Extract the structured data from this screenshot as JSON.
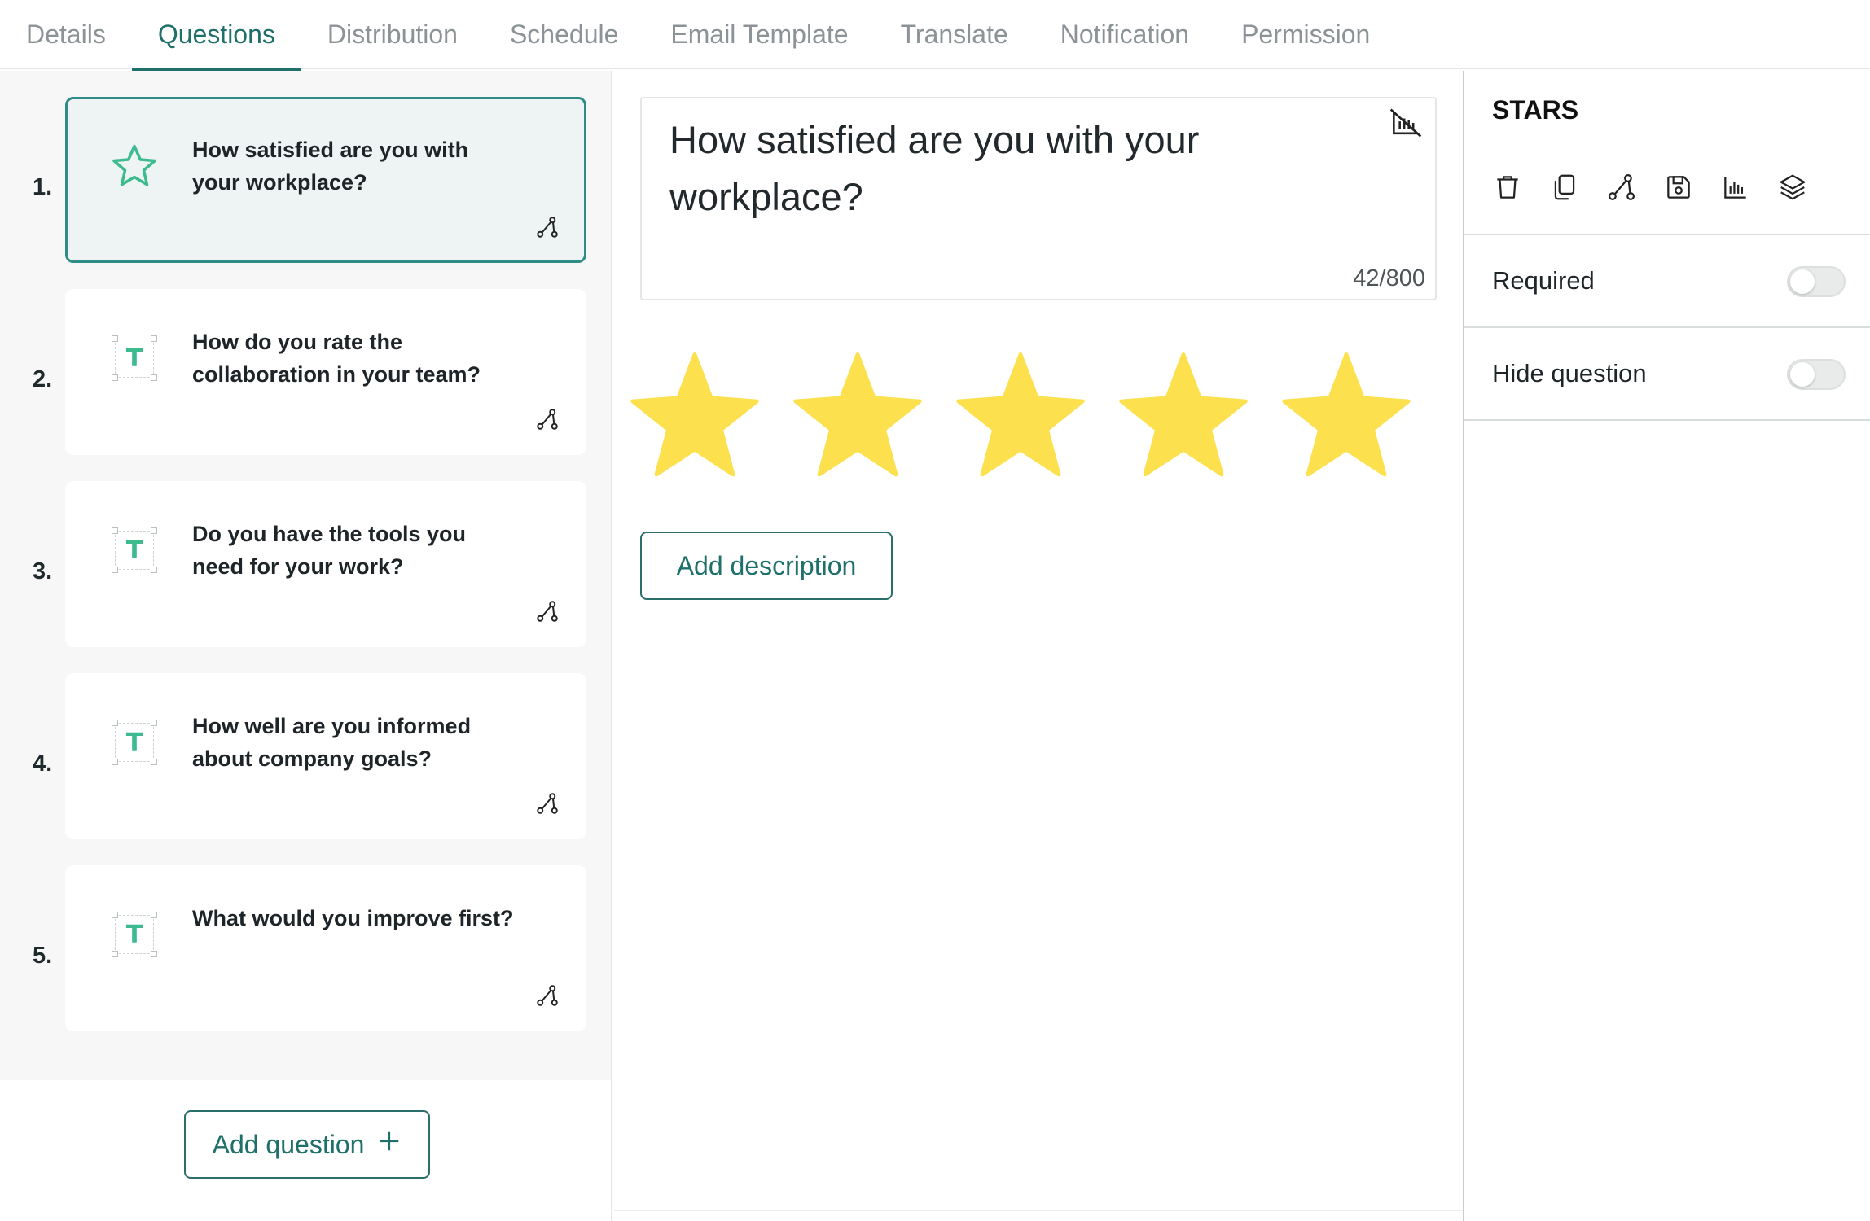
{
  "tabs": [
    {
      "label": "Details"
    },
    {
      "label": "Questions"
    },
    {
      "label": "Distribution"
    },
    {
      "label": "Schedule"
    },
    {
      "label": "Email Template"
    },
    {
      "label": "Translate"
    },
    {
      "label": "Notification"
    },
    {
      "label": "Permission"
    }
  ],
  "active_tab": "Questions",
  "questions": [
    {
      "number": "1.",
      "text": "How satisfied are you with your workplace?",
      "type_icon": "star-icon",
      "selected": true
    },
    {
      "number": "2.",
      "text": "How do you rate the collaboration in your team?",
      "type_icon": "text-icon",
      "type_letter": "T"
    },
    {
      "number": "3.",
      "text": "Do you have the tools you need for your work?",
      "type_icon": "text-icon",
      "type_letter": "T"
    },
    {
      "number": "4.",
      "text": "How well are you informed about company goals?",
      "type_icon": "text-icon",
      "type_letter": "T"
    },
    {
      "number": "5.",
      "text": "What would you improve first?",
      "type_icon": "text-icon",
      "type_letter": "T"
    }
  ],
  "add_question_label": "Add question",
  "editor": {
    "question_text": "How satisfied are you with your workplace?",
    "char_count": "42/800",
    "star_count": 5,
    "add_description_label": "Add description"
  },
  "settings_panel": {
    "title": "STARS",
    "tools": [
      "trash-icon",
      "copy-icon",
      "logic-icon",
      "save-icon",
      "chart-icon",
      "layers-icon"
    ],
    "options": [
      {
        "label": "Required",
        "enabled": false
      },
      {
        "label": "Hide question",
        "enabled": false
      }
    ]
  },
  "colors": {
    "accent": "#1f6f6a",
    "selected_border": "#2f8c86",
    "star_fill": "#fde04e",
    "type_icon": "#3dbb8f"
  }
}
